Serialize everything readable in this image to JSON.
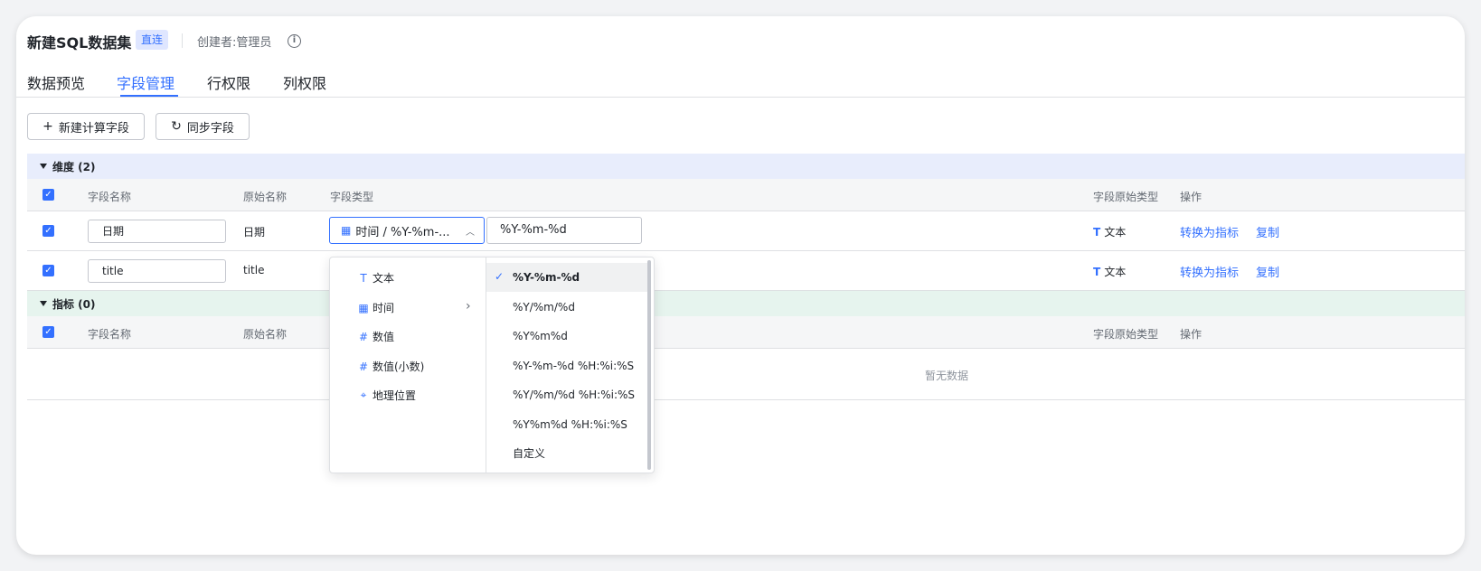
{
  "header": {
    "title": "新建SQL数据集",
    "badge": "直连",
    "creator": "创建者:管理员",
    "info_icon": "info-circle-icon"
  },
  "tabs": [
    {
      "label": "数据预览",
      "active": false
    },
    {
      "label": "字段管理",
      "active": true
    },
    {
      "label": "行权限",
      "active": false
    },
    {
      "label": "列权限",
      "active": false
    }
  ],
  "toolbar": {
    "add_calc_field": "新建计算字段",
    "sync_fields": "同步字段"
  },
  "dimension": {
    "label": "维度 (2)",
    "columns": [
      "字段名称",
      "原始名称",
      "字段类型",
      "字段原始类型",
      "操作"
    ],
    "rows": [
      {
        "name": "日期",
        "original": "日期",
        "type_selected": "时间 / %Y-%m-...",
        "format": "%Y-%m-%d",
        "raw_type": "文本",
        "action1": "转换为指标",
        "action2": "复制"
      },
      {
        "name": "title",
        "original": "title",
        "raw_type": "文本",
        "action1": "转换为指标",
        "action2": "复制"
      }
    ]
  },
  "metric": {
    "label": "指标 (0)",
    "columns": [
      "字段名称",
      "原始名称",
      "字段原始类型",
      "操作"
    ],
    "empty": "暂无数据"
  },
  "dropdown": {
    "types": [
      {
        "label": "文本",
        "icon": "T"
      },
      {
        "label": "时间",
        "icon": "calendar-icon"
      },
      {
        "label": "数值",
        "icon": "#"
      },
      {
        "label": "数值(小数)",
        "icon": "#"
      },
      {
        "label": "地理位置",
        "icon": "location-pin-icon"
      }
    ],
    "formats": [
      "%Y-%m-%d",
      "%Y/%m/%d",
      "%Y%m%d",
      "%Y-%m-%d %H:%i:%S",
      "%Y/%m/%d %H:%i:%S",
      "%Y%m%d %H:%i:%S",
      "自定义"
    ],
    "selected_format": "%Y-%m-%d"
  },
  "colors": {
    "accent": "#3370ff",
    "dim_bg": "#e8edfc",
    "metric_bg": "#e6f4ee"
  }
}
